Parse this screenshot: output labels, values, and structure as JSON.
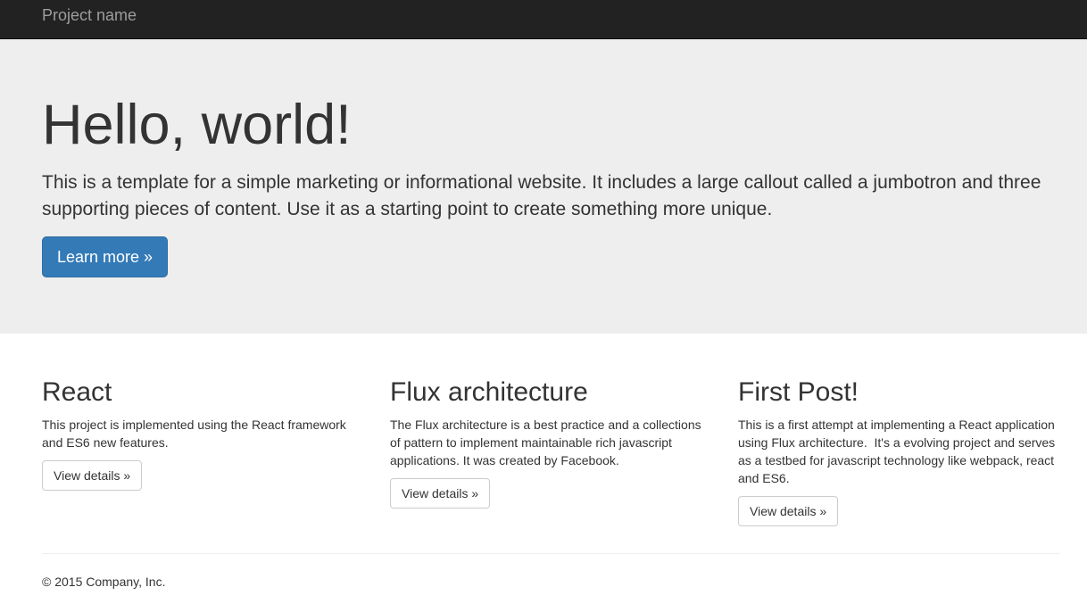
{
  "navbar": {
    "brand": "Project name"
  },
  "jumbotron": {
    "title": "Hello, world!",
    "lead": "This is a template for a simple marketing or informational website. It includes a large callout called a jumbotron and three supporting pieces of content. Use it as a starting point to create something more unique.",
    "button_label": "Learn more »"
  },
  "columns": [
    {
      "heading": "React",
      "text": "This project is implemented using the React framework and ES6 new features.",
      "button_label": "View details »"
    },
    {
      "heading": "Flux architecture",
      "text": "The Flux architecture is a best practice and a collections of pattern to implement maintainable rich javascript applications. It was created by Facebook.",
      "button_label": "View details »"
    },
    {
      "heading": "First Post!",
      "text": "This is a first attempt at implementing a React application using Flux architecture.  It's a evolving project and serves as a testbed for javascript technology like webpack, react and ES6.",
      "button_label": "View details »"
    }
  ],
  "footer": {
    "text": "© 2015 Company, Inc."
  },
  "colors": {
    "navbar_bg": "#222222",
    "jumbotron_bg": "#eeeeee",
    "primary": "#337ab7"
  }
}
